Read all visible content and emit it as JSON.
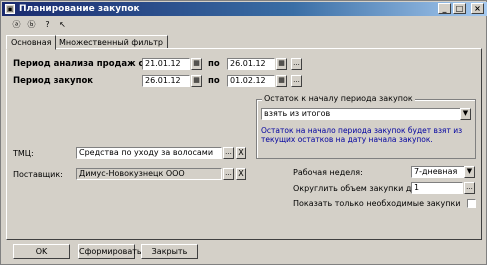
{
  "window": {
    "title": "Планирование закупок"
  },
  "titlebar_buttons": {
    "minimize": "_",
    "maximize": "□",
    "close": "×"
  },
  "toolbar": {
    "tools": [
      "ⓐ",
      "ⓑ",
      "?",
      "↖"
    ]
  },
  "tabs": [
    {
      "label": "Основная"
    },
    {
      "label": "Множественный фильтр"
    }
  ],
  "form": {
    "sales_period_label": "Период анализа продаж с",
    "sales_period_from": "21.01.12",
    "sales_period_to_label": "по",
    "sales_period_to": "26.01.12",
    "purchase_period_label": "Период закупок",
    "purchase_period_from": "26.01.12",
    "purchase_period_to_label": "по",
    "purchase_period_to": "01.02.12",
    "group_title": "Остаток к началу периода закупок",
    "remainder_select": "взять из итогов",
    "remainder_note": "Остаток на начало периода закупок будет взят из текущих остатков на дату начала закупок.",
    "tmc_label": "ТМЦ:",
    "tmc_value": "Средства по уходу за волосами",
    "supplier_label": "Поставщик:",
    "supplier_value": "Димус-Новокузнецк ООО",
    "work_week_label": "Рабочая неделя:",
    "work_week_value": "7-дневная",
    "round_label": "Округлить объем закупки до:",
    "round_value": "1",
    "only_needed_label": "Показать только необходимые закупки",
    "ellipsis": "...",
    "clear": "X",
    "dropdown_arrow": "▼"
  },
  "buttons": {
    "ok": "OK",
    "generate": "Сформировать",
    "close": "Закрыть"
  }
}
